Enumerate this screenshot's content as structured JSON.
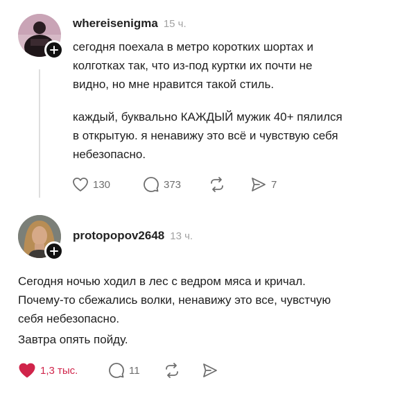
{
  "posts": [
    {
      "username": "whereisenigma",
      "time": "15 ч.",
      "paragraphs": [
        [
          "сегодня поехала в метро коротких шортах и",
          "колготках так, что из-под куртки их почти не",
          "видно, но мне нравится такой стиль."
        ],
        [
          "каждый, буквально КАЖДЫЙ мужик 40+ пялился",
          "в открытую. я ненавижу это всё и чувствую себя",
          "небезопасно."
        ]
      ],
      "actions": {
        "likes": "130",
        "comments": "373",
        "shares": "7"
      }
    },
    {
      "username": "protopopov2648",
      "time": "13 ч.",
      "paragraphs": [
        [
          "Сегодня ночью ходил в лес с ведром мяса и кричал.",
          "Почему-то сбежались волки, ненавижу это все, чувстчую",
          "себя небезопасно."
        ],
        [
          "Завтра опять пойду."
        ]
      ],
      "actions": {
        "likes": "1,3 тыс.",
        "comments": "11"
      }
    }
  ],
  "icons": {
    "like": "heart-icon",
    "liked": "heart-filled-icon",
    "comment": "comment-icon",
    "repost": "repost-icon",
    "share": "send-icon",
    "follow": "plus-icon"
  },
  "colors": {
    "liked": "#d0244a",
    "meta": "#a2a2a2",
    "text": "#1e1e1e"
  }
}
